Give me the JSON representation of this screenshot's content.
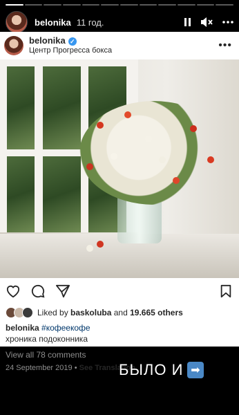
{
  "story": {
    "username": "belonika",
    "time": "11 год.",
    "progress_segments": 12,
    "progress_done": 1
  },
  "post": {
    "username": "belonika",
    "location": "Центр Прогресса бокса",
    "liked_by_prefix": "Liked by ",
    "liked_by_user": "baskoluba",
    "liked_by_and": " and ",
    "liked_by_count": "19.665 others",
    "caption_user": "belonika",
    "caption_hashtag": "#кофеекофе",
    "caption_line2": "хроника подоконника",
    "view_comments": "View all 78 comments",
    "date": "24 September 2019",
    "date_sep": " • ",
    "see_translation": "See Translation"
  },
  "overlay": {
    "text": "БЫЛО И",
    "arrow": "➡"
  },
  "colors": {
    "verified": "#3897f0",
    "hashtag": "#00376b",
    "arrow_bg": "#4a88c6"
  }
}
